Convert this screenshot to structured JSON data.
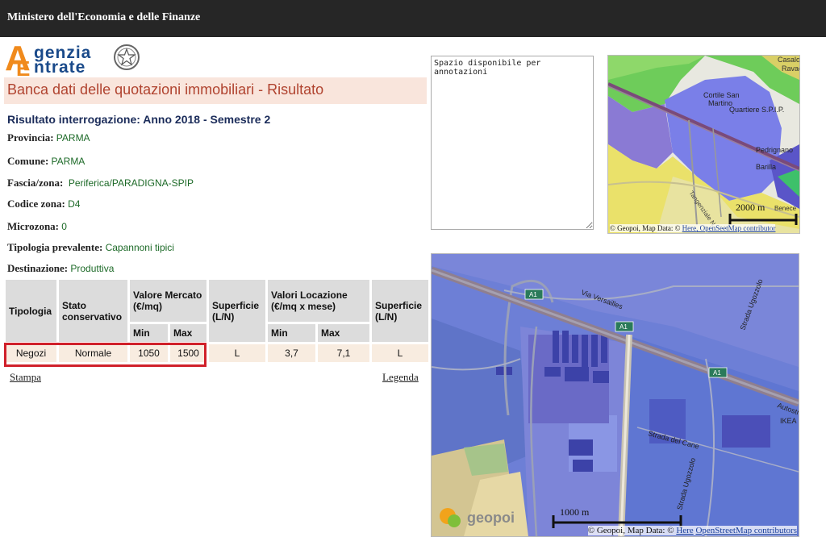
{
  "header": {
    "title": "Ministero dell'Economia e delle Finanze"
  },
  "logo": {
    "line1": "genzia",
    "line2": "ntrate",
    "letter_a": "A",
    "letter_e": "E"
  },
  "page": {
    "banner": "Banca dati delle quotazioni immobiliari - Risultato",
    "result_title": "Risultato interrogazione: Anno 2018 - Semestre 2"
  },
  "fields": [
    {
      "label": "Provincia:",
      "value": "PARMA"
    },
    {
      "label": "Comune:",
      "value": "PARMA"
    },
    {
      "label": "Fascia/zona:",
      "value": "Periferica/PARADIGNA-SPIP"
    },
    {
      "label": "Codice zona:",
      "value": "D4"
    },
    {
      "label": "Microzona:",
      "value": "0"
    },
    {
      "label": "Tipologia prevalente:",
      "value": "Capannoni tipici"
    },
    {
      "label": "Destinazione:",
      "value": "Produttiva"
    }
  ],
  "table": {
    "headers": {
      "tipologia": "Tipologia",
      "stato": "Stato conservativo",
      "valore_mercato": "Valore Mercato (€/mq)",
      "superficie": "Superficie (L/N)",
      "valori_locazione": "Valori Locazione (€/mq x mese)",
      "superficie2": "Superficie (L/N)",
      "min": "Min",
      "max": "Max",
      "min2": "Min",
      "max2": "Max"
    },
    "row": {
      "tipologia": "Negozi",
      "stato": "Normale",
      "vm_min": "1050",
      "vm_max": "1500",
      "superficie": "L",
      "vl_min": "3,7",
      "vl_max": "7,1",
      "superficie2": "L"
    }
  },
  "links": {
    "stampa": "Stampa",
    "legenda": "Legenda"
  },
  "notes": {
    "text": "Spazio disponibile per annotazioni"
  },
  "map_small": {
    "labels": {
      "casalo": "Casalor",
      "ravad": "Ravad",
      "cortile": "Cortile San",
      "martino": "Martino",
      "quartiere": "Quartiere S.P.I.P.",
      "pedrignano": "Pedrignano",
      "barilla": "Barilla",
      "tangenziale": "Tangenziale N",
      "benece": "Benece"
    },
    "scale": "2000 m",
    "attribution_prefix": "© Geopoi, Map Data: © ",
    "attribution_here": "Here",
    "attribution_osm": ", OpenS​eetMap contributor"
  },
  "map_large": {
    "labels": {
      "a1_1": "A1",
      "a1_2": "A1",
      "a1_3": "A1",
      "versailles": "Via Versailles",
      "ugozzolo_top": "Strada Ugozzolo",
      "autostr": "Autostr",
      "ikea": "IKEA",
      "cane": "Strada del Cane",
      "ugozzolo_bottom": "Strada Ugozzolo",
      "geopoi": "geopoi"
    },
    "scale": "1000 m",
    "attribution_prefix": "© Geopoi, Map Data: © ",
    "attribution_here": "Here",
    "attribution_osm": "OpenStreetMap contributors"
  },
  "colors": {
    "header_bg": "#262626",
    "banner_bg": "#f9e5dc",
    "banner_text": "#b0432f",
    "value_green": "#1d6a28",
    "highlight": "#d0202a"
  }
}
